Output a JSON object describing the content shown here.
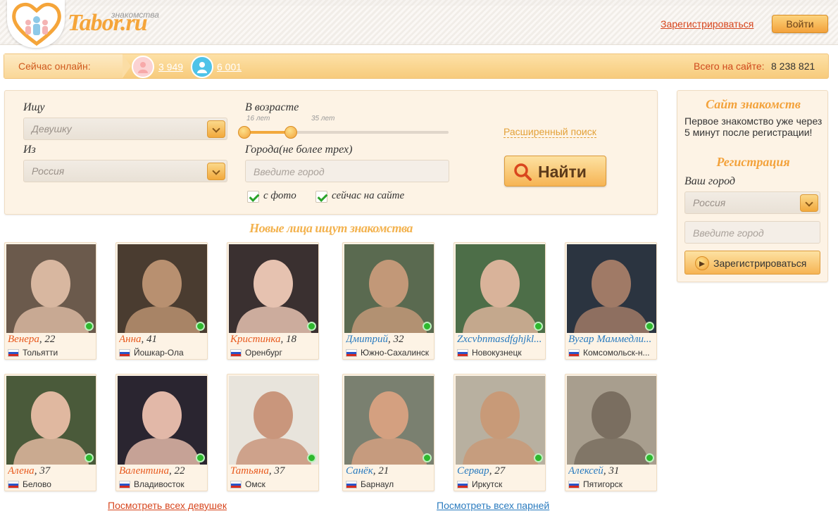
{
  "header": {
    "brand": "Tabor.ru",
    "tagline": "знакомства",
    "register_link": "Зарегистрироваться",
    "login_button": "Войти"
  },
  "online_bar": {
    "label": "Сейчас онлайн:",
    "female_count": "3 949",
    "male_count": "6 001",
    "total_label": "Всего на сайте:",
    "total_value": "8 238 821"
  },
  "search": {
    "looking_for_label": "Ищу",
    "looking_for_value": "Девушку",
    "from_label": "Из",
    "from_value": "Россия",
    "age_label": "В возрасте",
    "age_min_label": "16 лет",
    "age_max_label": "35 лет",
    "age_min": 16,
    "age_max": 35,
    "cities_label": "Города(не более трех)",
    "city_placeholder": "Введите город",
    "with_photo": "с фото",
    "online_now": "сейчас на сайте",
    "advanced_search": "Расширенный поиск",
    "find_button": "Найти"
  },
  "faces": {
    "title": "Новые лица ищут знакомства",
    "cards": [
      {
        "name": "Венера",
        "age": ", 22",
        "city": "Тольятти",
        "gender": "f"
      },
      {
        "name": "Анна",
        "age": ", 41",
        "city": "Йошкар-Ола",
        "gender": "f"
      },
      {
        "name": "Кристинка",
        "age": ", 18",
        "city": "Оренбург",
        "gender": "f"
      },
      {
        "name": "Дмитрий",
        "age": ", 32",
        "city": "Южно-Сахалинск",
        "gender": "m"
      },
      {
        "name": "Zxcvbnmasdfghjkl...",
        "age": "",
        "city": "Новокузнецк",
        "gender": "m"
      },
      {
        "name": "Вугар Маммедли...",
        "age": "",
        "city": "Комсомольск-н...",
        "gender": "m"
      },
      {
        "name": "Алена",
        "age": ", 37",
        "city": "Белово",
        "gender": "f"
      },
      {
        "name": "Валентина",
        "age": ", 22",
        "city": "Владивосток",
        "gender": "f"
      },
      {
        "name": "Татьяна",
        "age": ", 37",
        "city": "Омск",
        "gender": "f"
      },
      {
        "name": "Санёк",
        "age": ", 21",
        "city": "Барнаул",
        "gender": "m"
      },
      {
        "name": "Сервар",
        "age": ", 27",
        "city": "Иркутск",
        "gender": "m"
      },
      {
        "name": "Алексей",
        "age": ", 31",
        "city": "Пятигорск",
        "gender": "m"
      }
    ],
    "all_girls": "Посмотреть всех девушек",
    "all_boys": "Посмотреть всех парней"
  },
  "side": {
    "title": "Сайт знакомств",
    "text": "Первое знакомство уже через 5 минут после регистрации!",
    "reg_title": "Регистрация",
    "city_label": "Ваш город",
    "city_value": "Россия",
    "city_placeholder": "Введите город",
    "register_button": "Зарегистрироваться"
  },
  "colors": {
    "accent": "#f3a23b",
    "female_link": "#e85a1e",
    "male_link": "#2a7bbf",
    "online_dot": "#2eb82e"
  }
}
